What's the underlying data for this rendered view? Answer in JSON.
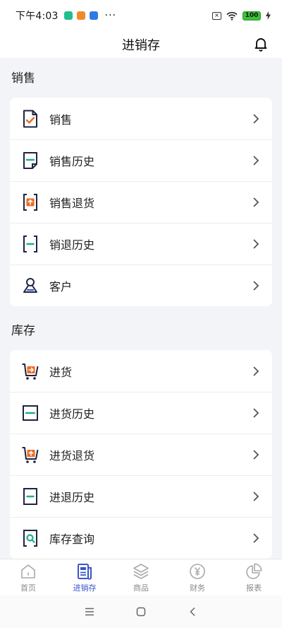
{
  "status_bar": {
    "time": "下午4:03",
    "more": "···",
    "battery": "100"
  },
  "header": {
    "title": "进销存"
  },
  "sections": [
    {
      "title": "销售",
      "items": [
        {
          "label": "销售",
          "icon": "sale-document-icon"
        },
        {
          "label": "销售历史",
          "icon": "sale-history-icon"
        },
        {
          "label": "销售退货",
          "icon": "sale-return-icon"
        },
        {
          "label": "销退历史",
          "icon": "sale-return-history-icon"
        },
        {
          "label": "客户",
          "icon": "customer-icon"
        }
      ]
    },
    {
      "title": "库存",
      "items": [
        {
          "label": "进货",
          "icon": "purchase-cart-icon"
        },
        {
          "label": "进货历史",
          "icon": "purchase-history-icon"
        },
        {
          "label": "进货退货",
          "icon": "purchase-return-cart-icon"
        },
        {
          "label": "进退历史",
          "icon": "purchase-return-history-icon"
        },
        {
          "label": "库存查询",
          "icon": "inventory-search-icon"
        }
      ]
    }
  ],
  "tabs": [
    {
      "label": "首页",
      "icon": "home-icon",
      "active": false
    },
    {
      "label": "进销存",
      "icon": "document-list-icon",
      "active": true
    },
    {
      "label": "商品",
      "icon": "layers-icon",
      "active": false
    },
    {
      "label": "财务",
      "icon": "yen-coin-icon",
      "active": false
    },
    {
      "label": "报表",
      "icon": "pie-chart-icon",
      "active": false
    }
  ],
  "colors": {
    "accent": "#3a55c8",
    "icon_dark": "#1e2440",
    "icon_orange": "#ef6a1f",
    "icon_green": "#1fae8a",
    "background": "#f3f4f7"
  }
}
